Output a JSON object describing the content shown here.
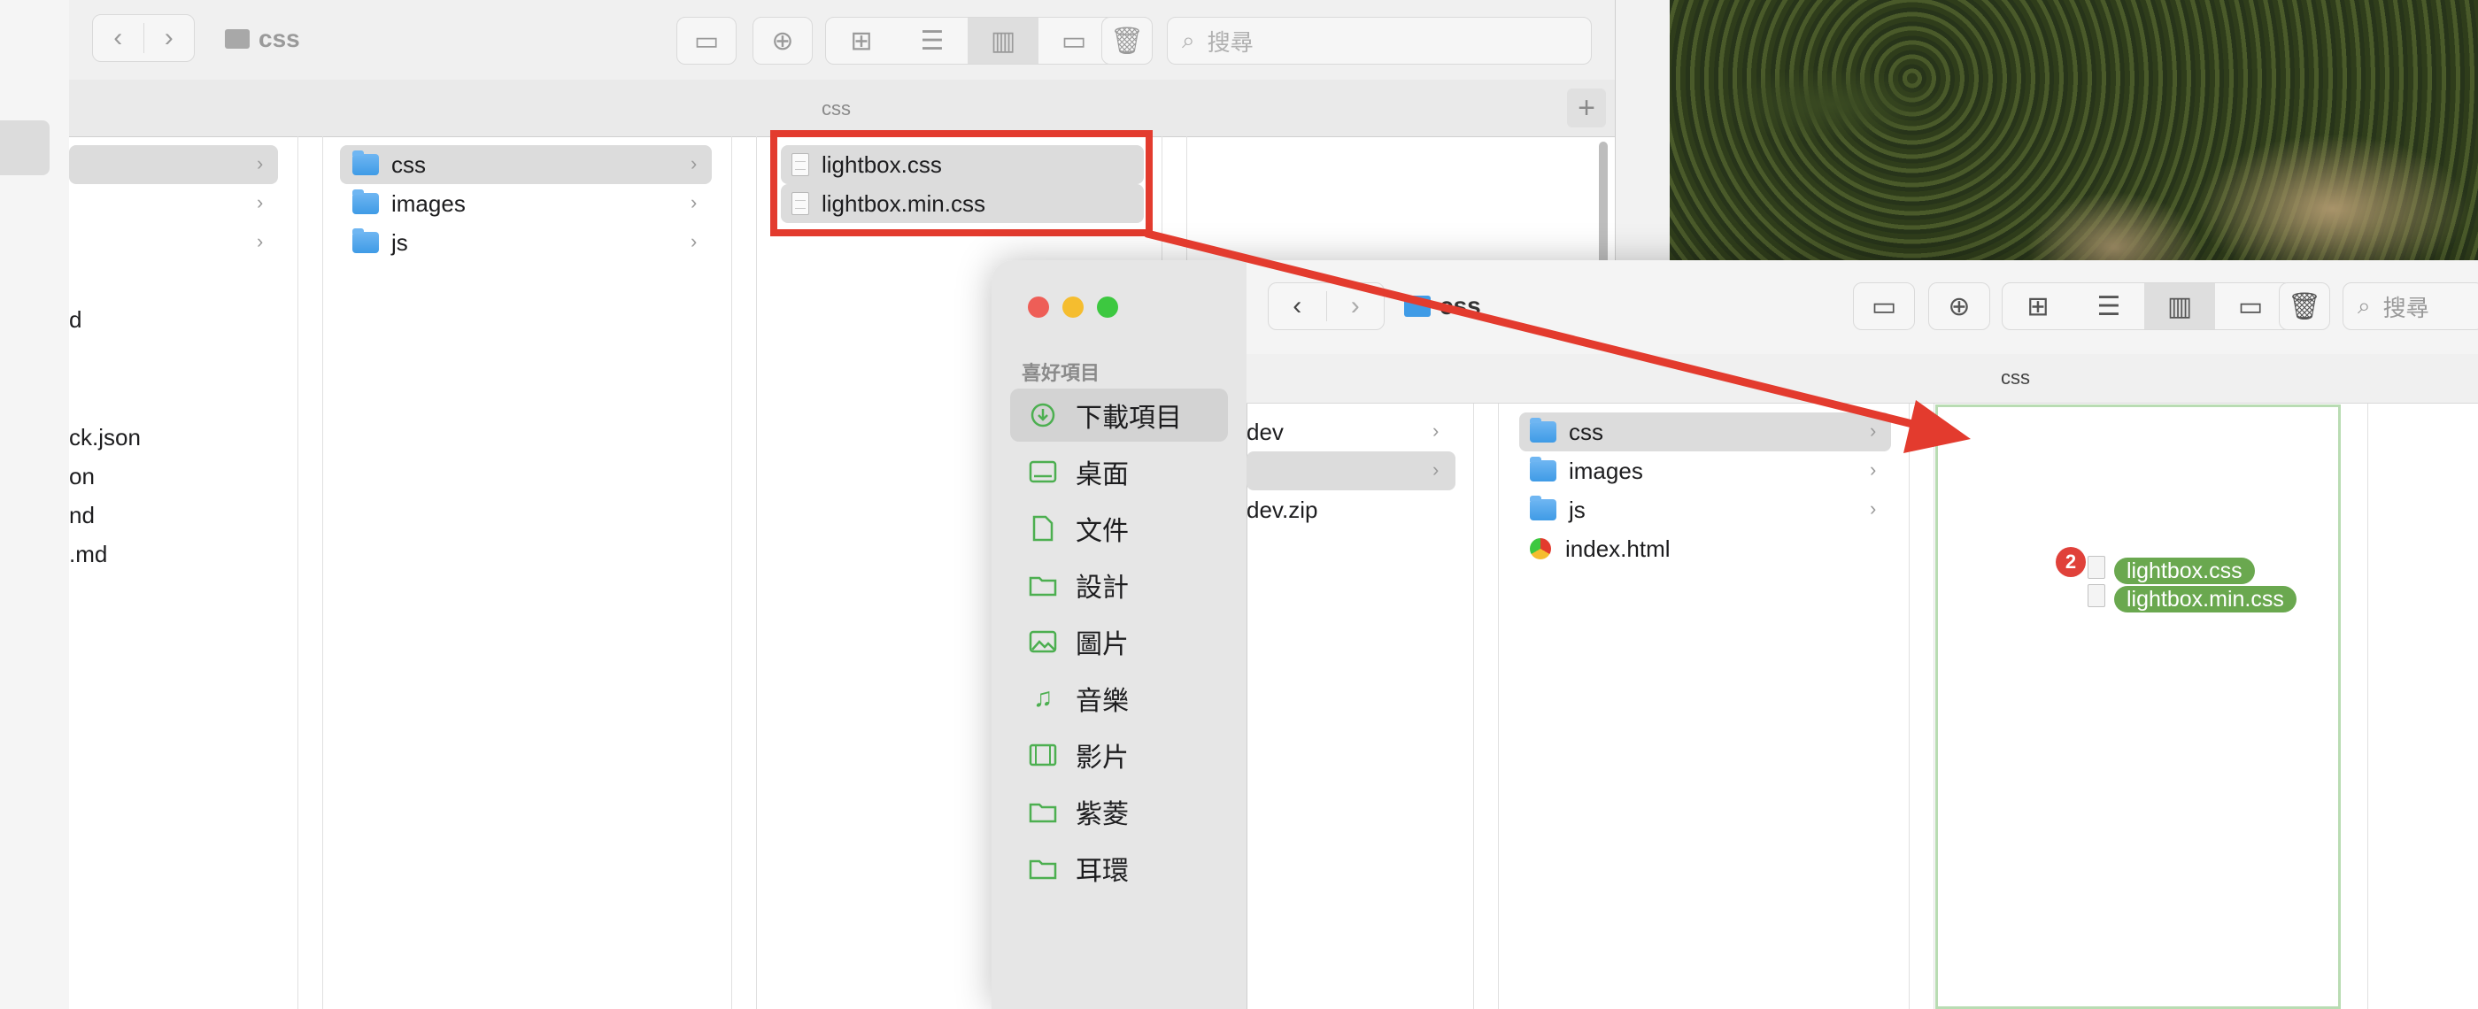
{
  "back_window": {
    "title": "css",
    "search_placeholder": "搜尋",
    "tab_label": "css",
    "col1_rows": [
      "d",
      "ck.json",
      "on",
      "nd",
      ".md"
    ],
    "col2_rows": [
      "css",
      "images",
      "js"
    ],
    "col3_rows": [
      "lightbox.css",
      "lightbox.min.css"
    ]
  },
  "front_window": {
    "title": "css",
    "search_placeholder": "搜尋",
    "tab_label": "css",
    "sidebar_section": "喜好項目",
    "sidebar_items": [
      {
        "label": "下載項目",
        "icon": "download-icon"
      },
      {
        "label": "桌面",
        "icon": "desktop-icon"
      },
      {
        "label": "文件",
        "icon": "document-icon"
      },
      {
        "label": "設計",
        "icon": "folder-icon"
      },
      {
        "label": "圖片",
        "icon": "image-icon"
      },
      {
        "label": "音樂",
        "icon": "music-icon"
      },
      {
        "label": "影片",
        "icon": "video-icon"
      },
      {
        "label": "紫菱",
        "icon": "folder-icon"
      },
      {
        "label": "耳環",
        "icon": "folder-icon"
      }
    ],
    "col1_rows": [
      "dev",
      "",
      "dev.zip"
    ],
    "col2_rows": [
      "css",
      "images",
      "js",
      "index.html"
    ],
    "drag_items": [
      "lightbox.css",
      "lightbox.min.css"
    ],
    "drag_count": "2"
  },
  "colors": {
    "annotation_red": "#e33b2e",
    "drop_green": "#6aa84f",
    "folder_blue": "#3f9be6",
    "sidebar_green": "#4caf50"
  }
}
